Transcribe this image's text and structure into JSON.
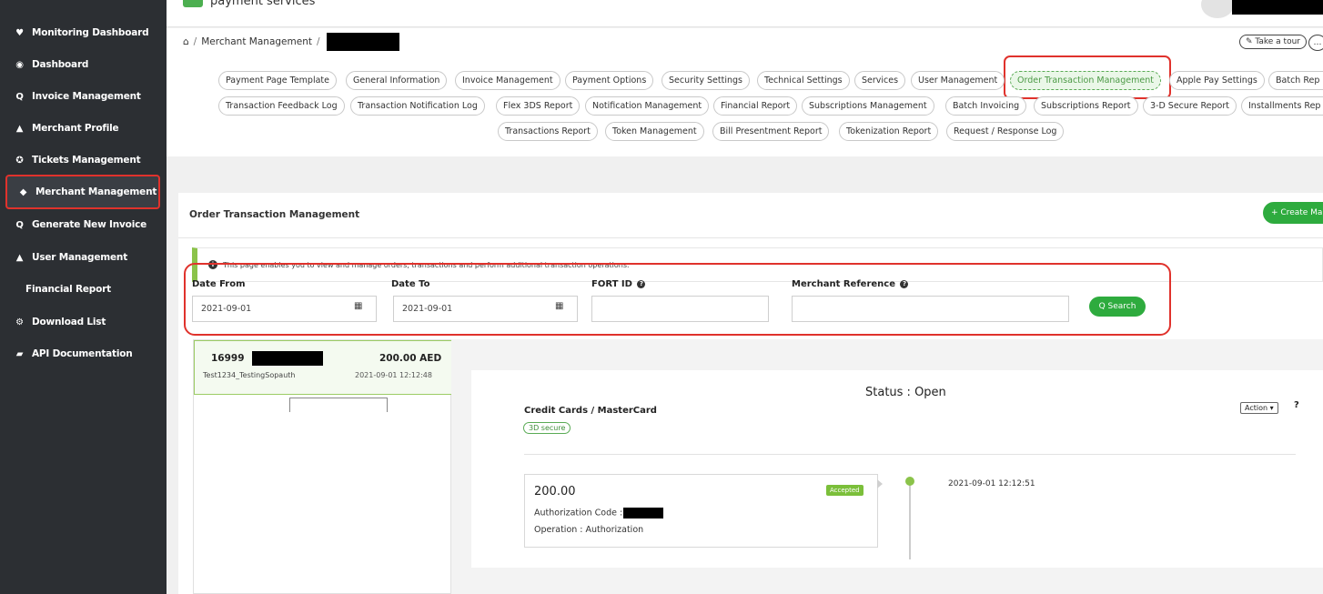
{
  "header": {
    "logo_text": "payment services"
  },
  "sidebar": {
    "items": [
      {
        "label": "Monitoring Dashboard",
        "icon": "heart-icon"
      },
      {
        "label": "Dashboard",
        "icon": "dashboard-icon"
      },
      {
        "label": "Invoice Management",
        "icon": "search-icon"
      },
      {
        "label": "Merchant Profile",
        "icon": "user-icon"
      },
      {
        "label": "Tickets Management",
        "icon": "lifebuoy-icon"
      },
      {
        "label": "Merchant Management",
        "icon": "tag-icon",
        "active": true
      },
      {
        "label": "Generate New Invoice",
        "icon": "search-icon"
      },
      {
        "label": "User Management",
        "icon": "user-icon"
      },
      {
        "label": "Financial Report",
        "icon": ""
      },
      {
        "label": "Download List",
        "icon": "gears-icon"
      },
      {
        "label": "API Documentation",
        "icon": "book-icon"
      }
    ],
    "glyphs": {
      "heart": "♥",
      "dashboard": "◉",
      "search": "Q",
      "user": "▲",
      "lifebuoy": "✪",
      "tag": "◆",
      "gears": "⚙",
      "book": "▰"
    }
  },
  "breadcrumb": {
    "home_icon": "⌂",
    "sep": "/",
    "item1": "Merchant Management",
    "sep2": "/"
  },
  "tour": {
    "label": "Take a tour",
    "pencil": "✎",
    "more": "…"
  },
  "tabs": {
    "row1": [
      "Payment Page Template",
      "General Information",
      "Invoice Management",
      "Payment Options",
      "Security Settings",
      "Technical Settings",
      "Services",
      "User Management",
      "Order Transaction Management",
      "Apple Pay Settings",
      "Batch Rep"
    ],
    "row2": [
      "Transaction Feedback Log",
      "Transaction Notification Log",
      "Flex 3DS Report",
      "Notification Management",
      "Financial Report",
      "Subscriptions Management",
      "Batch Invoicing",
      "Subscriptions Report",
      "3-D Secure Report",
      "Installments Rep"
    ],
    "row3": [
      "Transactions Report",
      "Token Management",
      "Bill Presentment Report",
      "Tokenization Report",
      "Request / Response Log"
    ],
    "active": "Order Transaction Management"
  },
  "panel": {
    "title": "Order Transaction Management",
    "create_label": "+ Create Ma",
    "info_text": "This page enables you to view and manage orders, transactions and perform additional transaction operations.",
    "info_icon": "i"
  },
  "filters": {
    "date_from_label": "Date From",
    "date_from_value": "2021-09-01",
    "date_to_label": "Date To",
    "date_to_value": "2021-09-01",
    "fort_id_label": "FORT ID",
    "merchant_ref_label": "Merchant Reference",
    "help_glyph": "?",
    "calendar_glyph": "▦",
    "search_label": "Q Search"
  },
  "order": {
    "id_prefix": "16999",
    "amount": "200.00 AED",
    "name": "Test1234_TestingSopauth",
    "time": "2021-09-01 12:12:48"
  },
  "detail": {
    "status": "Status : Open",
    "method": "Credit Cards / MasterCard",
    "badge": "3D secure",
    "action_label": "Action ▾",
    "help": "?",
    "txn_amount": "200.00",
    "auth_label": "Authorization Code :",
    "operation": "Operation : Authorization",
    "accepted": "Accepted",
    "timeline_time": "2021-09-01 12:12:51"
  },
  "colors": {
    "accent_green": "#2eab3e",
    "highlight_red": "#e0322c",
    "sidebar_bg": "#2c2f33"
  }
}
